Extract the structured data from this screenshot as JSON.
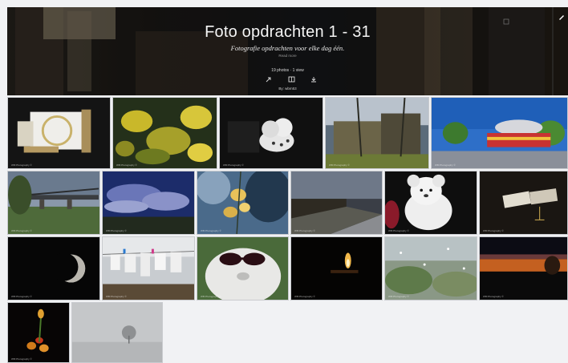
{
  "album": {
    "title": "Foto opdrachten 1 - 31",
    "subtitle": "Fotografie opdrachten voor elke dag één.",
    "read_more": "Read more",
    "stats": "19 photos  ·  1 view",
    "byline": "By: wbm53"
  },
  "actions": [
    {
      "name": "share-icon",
      "glyph": "⇗"
    },
    {
      "name": "slideshow-icon",
      "glyph": "▭"
    },
    {
      "name": "download-icon",
      "glyph": "⤓"
    }
  ],
  "watermark": "WB Photography ©",
  "photos": [
    "embroidery-hoop",
    "yellow-leaves",
    "baby-shoes",
    "abandoned-building",
    "carousel-fair",
    "railway-bridge",
    "cloudy-sky",
    "orchid",
    "country-road",
    "teddy-bear",
    "playing-cards",
    "moon",
    "laundry-line",
    "sunglasses-statue",
    "candle",
    "rainy-window",
    "sunset-town",
    "tulip-bouquet",
    "foggy-tree"
  ],
  "colors": {
    "page_bg": "#f1f2f4",
    "header_text": "#f4f4f4"
  }
}
